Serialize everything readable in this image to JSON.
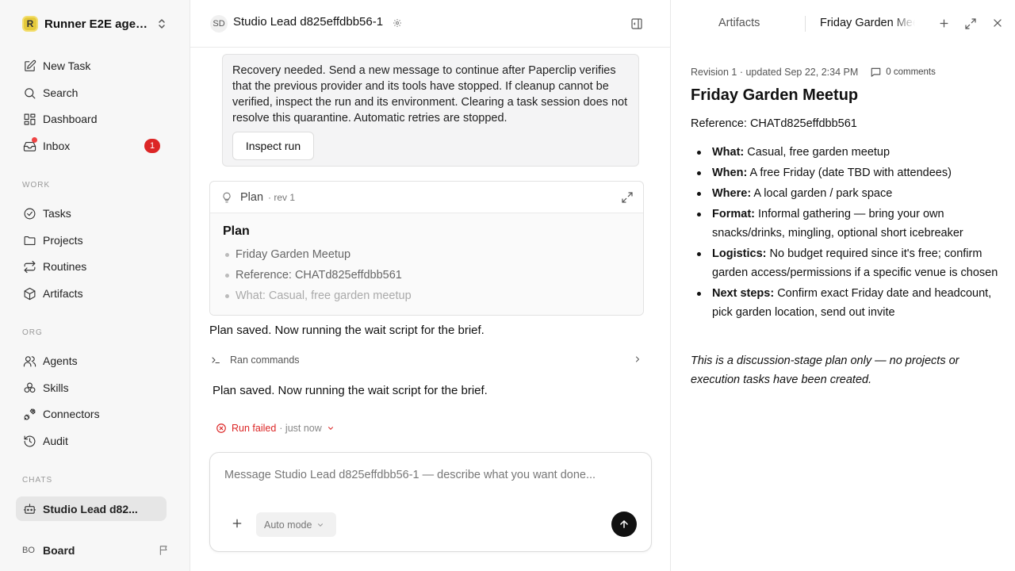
{
  "sidebar": {
    "workspace": {
      "logo": "R",
      "name": "Runner E2E agen..."
    },
    "top": [
      {
        "label": "New Task",
        "icon": "edit-icon"
      },
      {
        "label": "Search",
        "icon": "search-icon"
      },
      {
        "label": "Dashboard",
        "icon": "dashboard-icon"
      },
      {
        "label": "Inbox",
        "icon": "inbox-icon",
        "badge": "1"
      }
    ],
    "work_label": "WORK",
    "work": [
      {
        "label": "Tasks",
        "icon": "check-circle-icon"
      },
      {
        "label": "Projects",
        "icon": "folder-icon"
      },
      {
        "label": "Routines",
        "icon": "repeat-icon"
      },
      {
        "label": "Artifacts",
        "icon": "box-icon"
      }
    ],
    "org_label": "ORG",
    "org": [
      {
        "label": "Agents",
        "icon": "users-icon"
      },
      {
        "label": "Skills",
        "icon": "skills-icon"
      },
      {
        "label": "Connectors",
        "icon": "plug-icon"
      },
      {
        "label": "Audit",
        "icon": "history-icon"
      }
    ],
    "chats_label": "CHATS",
    "chats": [
      {
        "label": "Studio Lead d82...",
        "icon": "bot-icon",
        "active": true
      }
    ],
    "board": {
      "avatar": "BO",
      "label": "Board"
    }
  },
  "main": {
    "avatar": "SD",
    "title": "Studio Lead d825effdbb56-1",
    "recovery_text": "Recovery needed. Send a new message to continue after Paperclip verifies that the previous provider and its tools have stopped. If cleanup cannot be verified, inspect the run and its environment. Clearing a task session does not resolve this quarantine. Automatic retries are stopped.",
    "inspect_button": "Inspect run",
    "plan": {
      "label": "Plan",
      "rev": "· rev 1",
      "heading": "Plan",
      "items": [
        "Friday Garden Meetup",
        "Reference: CHATd825effdbb561",
        "What: Casual, free garden meetup"
      ]
    },
    "message_1": "Plan saved. Now running the wait script for the brief.",
    "ran_commands": "Ran commands",
    "message_2": "Plan saved. Now running the wait script for the brief.",
    "run_status": "Run failed",
    "run_time": "· just now",
    "composer": {
      "placeholder": "Message Studio Lead d825effdbb56-1 — describe what you want done...",
      "mode": "Auto mode"
    }
  },
  "panel": {
    "tab_artifacts": "Artifacts",
    "tab_active": "Friday Garden Meetup",
    "revision": "Revision 1 · updated Sep 22, 2:34 PM",
    "comments": "0 comments",
    "title": "Friday Garden Meetup",
    "reference": "Reference: CHATd825effdbb561",
    "items": [
      {
        "key": "What:",
        "text": " Casual, free garden meetup"
      },
      {
        "key": "When:",
        "text": " A free Friday (date TBD with attendees)"
      },
      {
        "key": "Where:",
        "text": " A local garden / park space"
      },
      {
        "key": "Format:",
        "text": " Informal gathering — bring your own snacks/drinks, mingling, optional short icebreaker"
      },
      {
        "key": "Logistics:",
        "text": " No budget required since it's free; confirm garden access/permissions if a specific venue is chosen"
      },
      {
        "key": "Next steps:",
        "text": " Confirm exact Friday date and headcount, pick garden location, send out invite"
      }
    ],
    "note": "This is a discussion-stage plan only — no projects or execution tasks have been created."
  },
  "colors": {
    "accent_red": "#dc2626",
    "send_button": "#111111",
    "workspace_logo": "#e5c93a"
  }
}
